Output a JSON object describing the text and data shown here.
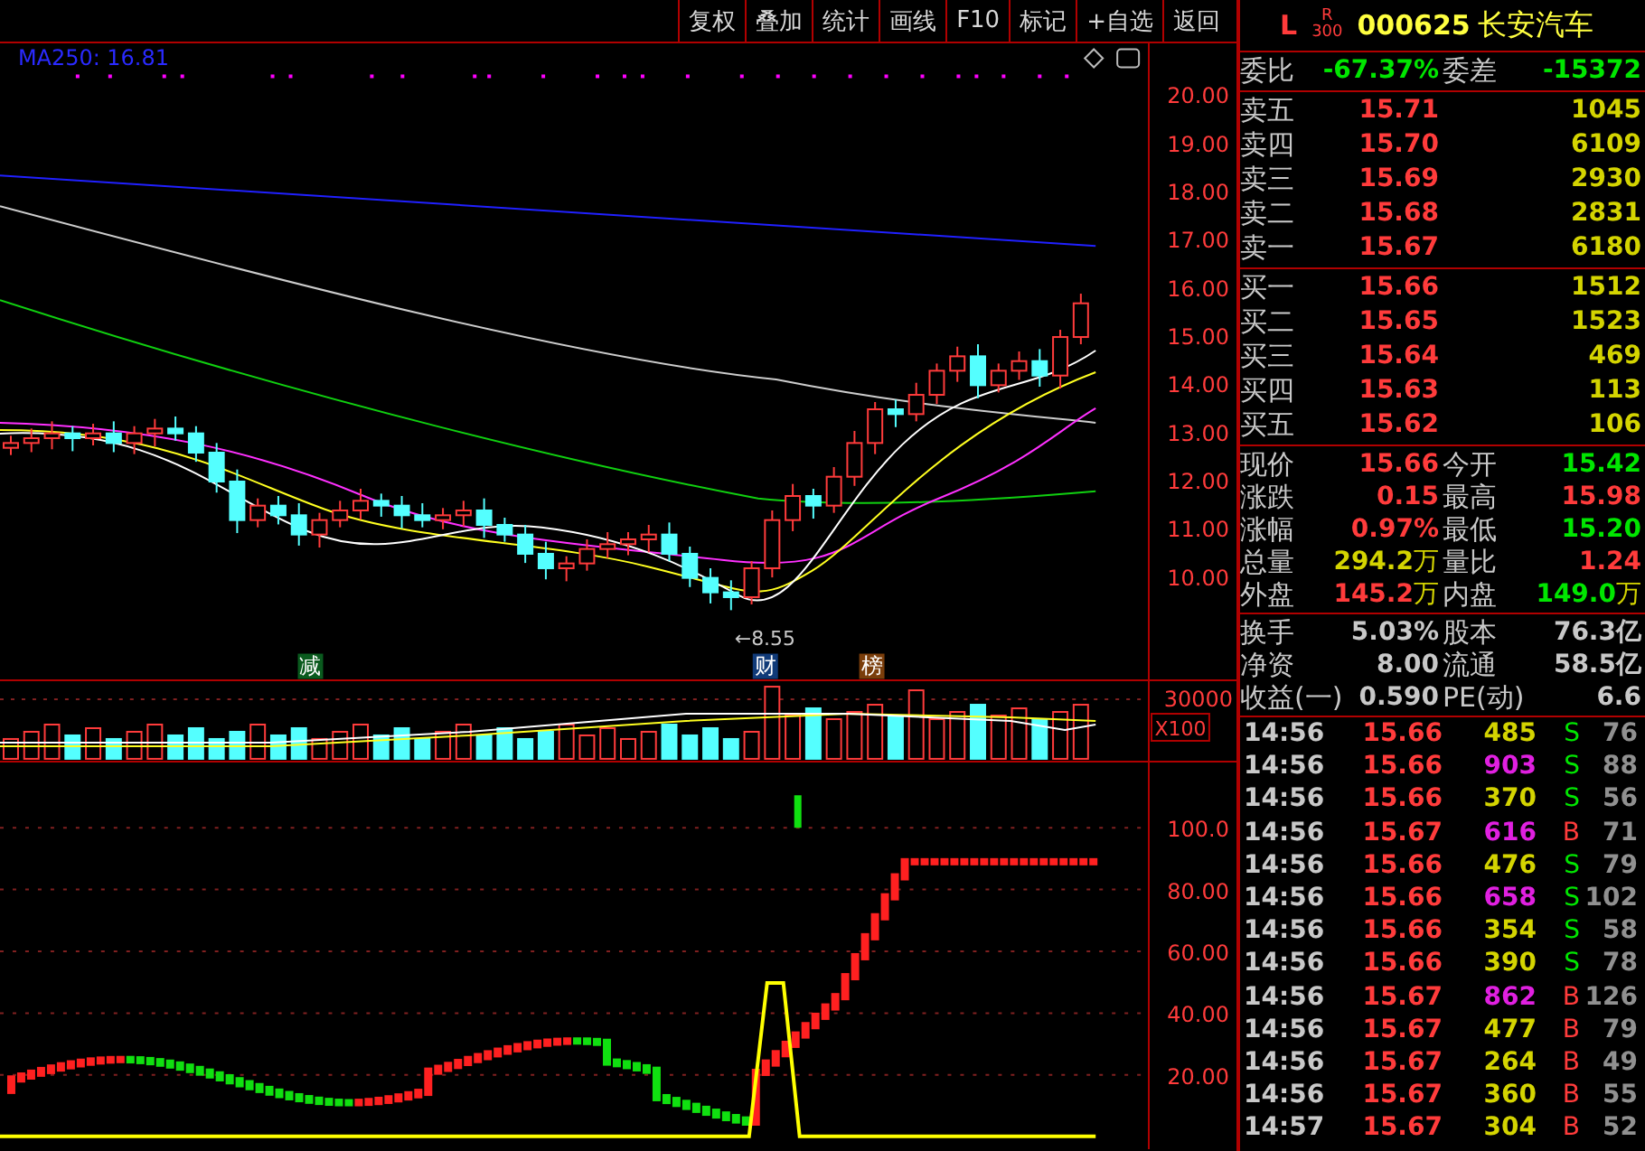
{
  "toolbar": {
    "buttons": [
      "复权",
      "叠加",
      "统计",
      "画线",
      "F10",
      "标记",
      "+自选",
      "返回"
    ]
  },
  "main_chart": {
    "indicator_label": "MA250: 16.81",
    "axis_labels": [
      "20.00",
      "19.00",
      "18.00",
      "17.00",
      "16.00",
      "15.00",
      "14.00",
      "13.00",
      "12.00",
      "11.00",
      "10.00"
    ],
    "tags": [
      {
        "text": "减",
        "color": "#0a5a1e"
      },
      {
        "text": "财",
        "color": "#103a78"
      },
      {
        "text": "榜",
        "color": "#7a3d0a"
      }
    ],
    "low_label": "←8.55"
  },
  "volume_chart": {
    "axis_label": "30000",
    "unit": "X100"
  },
  "indicator_chart": {
    "axis_labels": [
      "100.0",
      "80.00",
      "60.00",
      "40.00",
      "20.00"
    ]
  },
  "quote": {
    "market_tag": "L",
    "index_tag": "R",
    "index_number": "300",
    "code": "000625",
    "name": "长安汽车"
  },
  "order_ratio": [
    {
      "label": "委比",
      "value": "-67.37%",
      "color": "#00e600"
    },
    {
      "label": "委差",
      "value": "-15372",
      "color": "#00e600"
    }
  ],
  "asks": [
    {
      "label": "卖五",
      "price": "15.71",
      "volume": "1045"
    },
    {
      "label": "卖四",
      "price": "15.70",
      "volume": "6109"
    },
    {
      "label": "卖三",
      "price": "15.69",
      "volume": "2930"
    },
    {
      "label": "卖二",
      "price": "15.68",
      "volume": "2831"
    },
    {
      "label": "卖一",
      "price": "15.67",
      "volume": "6180"
    }
  ],
  "bids": [
    {
      "label": "买一",
      "price": "15.66",
      "volume": "1512"
    },
    {
      "label": "买二",
      "price": "15.65",
      "volume": "1523"
    },
    {
      "label": "买三",
      "price": "15.64",
      "volume": "469"
    },
    {
      "label": "买四",
      "price": "15.63",
      "volume": "113"
    },
    {
      "label": "买五",
      "price": "15.62",
      "volume": "106"
    }
  ],
  "stats": [
    {
      "label": "现价",
      "value": "15.66",
      "color": "#ff3b3b"
    },
    {
      "label": "今开",
      "value": "15.42",
      "color": "#00e600"
    },
    {
      "label": "涨跌",
      "value": "0.15",
      "color": "#ff3b3b"
    },
    {
      "label": "最高",
      "value": "15.98",
      "color": "#ff3b3b"
    },
    {
      "label": "涨幅",
      "value": "0.97%",
      "color": "#ff3b3b"
    },
    {
      "label": "最低",
      "value": "15.20",
      "color": "#00e600"
    },
    {
      "label": "总量",
      "value": "294.2",
      "unit": "万",
      "color": "#d4d400"
    },
    {
      "label": "量比",
      "value": "1.24",
      "color": "#ff3b3b"
    },
    {
      "label": "外盘",
      "value": "145.2",
      "unit": "万",
      "color": "#ff3b3b"
    },
    {
      "label": "内盘",
      "value": "149.0",
      "unit": "万",
      "color": "#00e600"
    }
  ],
  "fundamentals": [
    {
      "label": "换手",
      "value": "5.03%"
    },
    {
      "label": "股本",
      "value": "76.3亿"
    },
    {
      "label": "净资",
      "value": "8.00"
    },
    {
      "label": "流通",
      "value": "58.5亿"
    },
    {
      "label": "收益(一)",
      "value": "0.590"
    },
    {
      "label": "PE(动)",
      "value": "6.6"
    }
  ],
  "ticks": [
    {
      "time": "14:56",
      "price": "15.66",
      "volume": "485",
      "large": false,
      "side": "S",
      "count": "76"
    },
    {
      "time": "14:56",
      "price": "15.66",
      "volume": "903",
      "large": true,
      "side": "S",
      "count": "88"
    },
    {
      "time": "14:56",
      "price": "15.66",
      "volume": "370",
      "large": false,
      "side": "S",
      "count": "56"
    },
    {
      "time": "14:56",
      "price": "15.67",
      "volume": "616",
      "large": true,
      "side": "B",
      "count": "71"
    },
    {
      "time": "14:56",
      "price": "15.66",
      "volume": "476",
      "large": false,
      "side": "S",
      "count": "79"
    },
    {
      "time": "14:56",
      "price": "15.66",
      "volume": "658",
      "large": true,
      "side": "S",
      "count": "102"
    },
    {
      "time": "14:56",
      "price": "15.66",
      "volume": "354",
      "large": false,
      "side": "S",
      "count": "58"
    },
    {
      "time": "14:56",
      "price": "15.66",
      "volume": "390",
      "large": false,
      "side": "S",
      "count": "78"
    },
    {
      "time": "14:56",
      "price": "15.67",
      "volume": "862",
      "large": true,
      "side": "B",
      "count": "126"
    },
    {
      "time": "14:56",
      "price": "15.67",
      "volume": "477",
      "large": false,
      "side": "B",
      "count": "79"
    },
    {
      "time": "14:56",
      "price": "15.67",
      "volume": "264",
      "large": false,
      "side": "B",
      "count": "49"
    },
    {
      "time": "14:56",
      "price": "15.67",
      "volume": "360",
      "large": false,
      "side": "B",
      "count": "55"
    },
    {
      "time": "14:57",
      "price": "15.67",
      "volume": "304",
      "large": false,
      "side": "B",
      "count": "52"
    }
  ]
}
